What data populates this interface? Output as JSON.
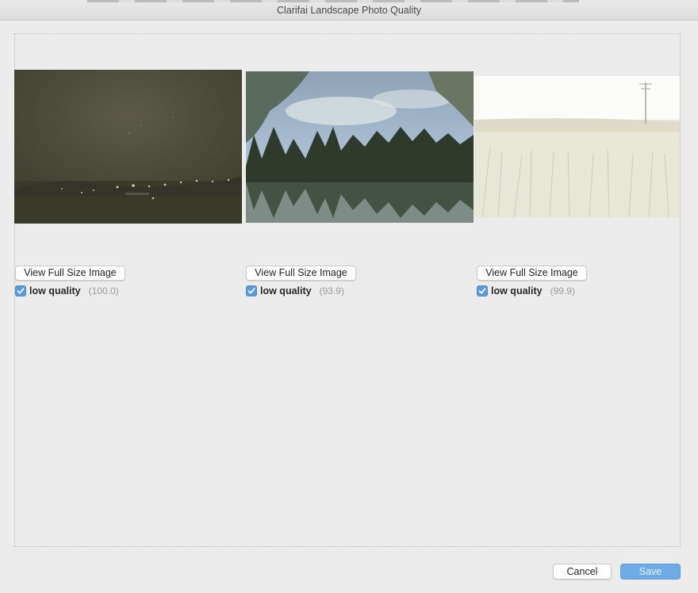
{
  "window": {
    "title": "Clarifai Landscape Photo Quality"
  },
  "photos": [
    {
      "view_button": "View Full Size Image",
      "label": "low quality",
      "score": "(100.0)",
      "checked": true,
      "image": "night-lake-lights-photo"
    },
    {
      "view_button": "View Full Size Image",
      "label": "low quality",
      "score": "(93.9)",
      "checked": true,
      "image": "lake-forest-reflection-photo"
    },
    {
      "view_button": "View Full Size Image",
      "label": "low quality",
      "score": "(99.9)",
      "checked": true,
      "image": "wheat-field-photo"
    }
  ],
  "footer": {
    "cancel_label": "Cancel",
    "save_label": "Save"
  },
  "colors": {
    "accent": "#5a9bd8",
    "save_button": "#6eaae6",
    "background": "#ececec"
  }
}
